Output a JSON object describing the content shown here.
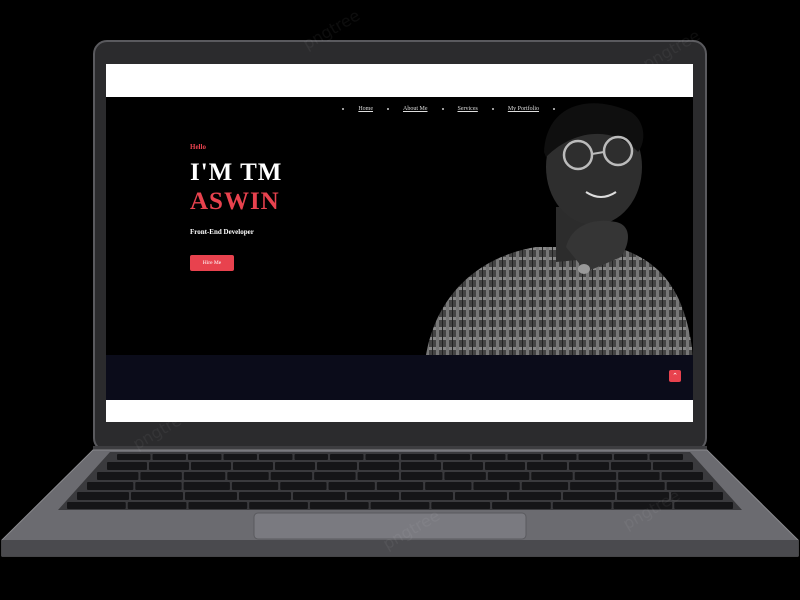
{
  "nav": {
    "items": [
      {
        "label": "Home"
      },
      {
        "label": "About Me"
      },
      {
        "label": "Services"
      },
      {
        "label": "My Portfolio"
      }
    ]
  },
  "hero": {
    "greeting": "Hello",
    "title_line1": "I'M TM",
    "title_line2": "ASWIN",
    "role": "Front-End Developer",
    "cta_label": "Hire Me",
    "photo_icon": "portrait-photo"
  },
  "scroll_top": {
    "icon": "arrow-up-icon",
    "glyph": "⌃"
  },
  "colors": {
    "accent": "#e8424e",
    "hero_bg": "#000000",
    "band_bg": "#0b0c1a",
    "laptop_frame": "#2b2b2d",
    "laptop_base": "#6b6b70"
  },
  "watermark": "pngtree"
}
